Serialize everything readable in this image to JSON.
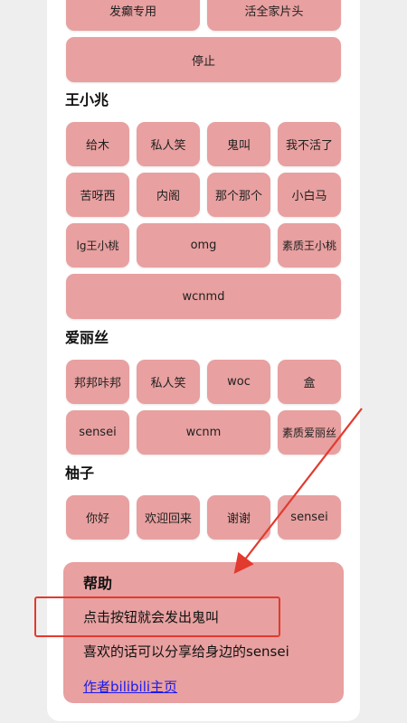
{
  "top_group": {
    "buttons": [
      "发癫专用",
      "活全家片头"
    ],
    "stop_label": "停止"
  },
  "sections": [
    {
      "title": "王小兆",
      "buttons": [
        "给木",
        "私人笑",
        "鬼叫",
        "我不活了",
        "苦呀西",
        "内阁",
        "那个那个",
        "小白马",
        "lg王小桃",
        "omg",
        "素质王小桃",
        "wcnmd"
      ]
    },
    {
      "title": "爱丽丝",
      "buttons": [
        "邦邦咔邦",
        "私人笑",
        "woc",
        "盒",
        "sensei",
        "wcnm",
        "素质爱丽丝"
      ]
    },
    {
      "title": "柚子",
      "buttons": [
        "你好",
        "欢迎回来",
        "谢谢",
        "sensei"
      ]
    }
  ],
  "help": {
    "title": "帮助",
    "line1": "点击按钮就会发出鬼叫",
    "line2": "喜欢的话可以分享给身边的sensei",
    "link": "作者bilibili主页"
  },
  "colors": {
    "button_bg": "#e8a0a0",
    "annotation_red": "#e23a2e",
    "link": "#1a1aee"
  }
}
